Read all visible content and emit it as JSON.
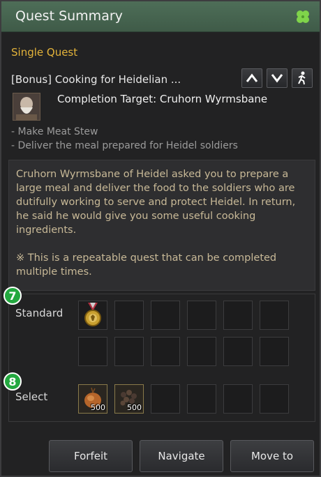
{
  "window": {
    "title": "Quest Summary",
    "title_icon": "four-leaf-clover-icon"
  },
  "quest": {
    "category": "Single Quest",
    "title": "[Bonus] Cooking for Heidelian ...",
    "controls": [
      "move-up",
      "move-down",
      "walk-to"
    ],
    "completion_target": "Completion Target: Cruhorn Wyrmsbane",
    "objectives": [
      "- Make Meat Stew",
      "- Deliver the meal prepared for Heidel soldiers"
    ],
    "description": "Cruhorn Wyrmsbane of Heidel asked you to prepare a large meal and deliver the food to the soldiers who are dutifully working to serve and protect Heidel. In return, he said he would give you some useful cooking ingredients.",
    "note": "※ This is a repeatable quest that can be completed multiple times."
  },
  "rewards": {
    "standard_badge": "7",
    "standard_label": "Standard",
    "select_badge": "8",
    "select_label": "Select",
    "standard_items": [
      {
        "icon": "medal-icon",
        "qty": ""
      }
    ],
    "select_items": [
      {
        "icon": "onion-icon",
        "qty": "500"
      },
      {
        "icon": "spice-seeds-icon",
        "qty": "500"
      }
    ]
  },
  "buttons": {
    "forfeit": "Forfeit",
    "navigate": "Navigate",
    "move_to": "Move to"
  },
  "colors": {
    "titlebar": "#4e6e58",
    "category": "#e3b33a",
    "description": "#c8b997",
    "badge": "#23a83f"
  }
}
